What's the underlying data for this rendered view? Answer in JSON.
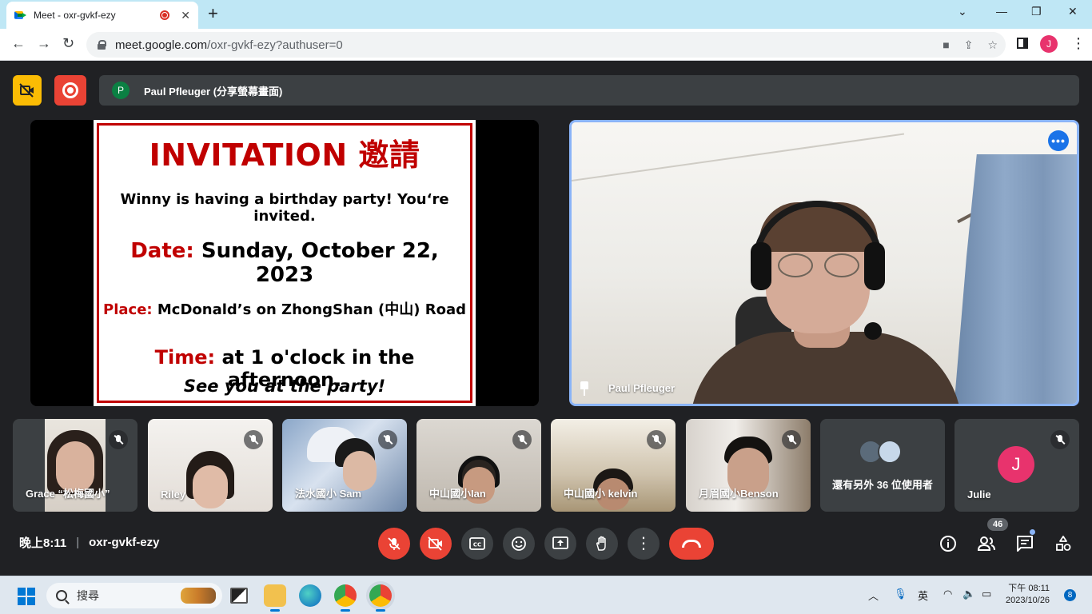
{
  "browser": {
    "tab_title": "Meet - oxr-gvkf-ezy",
    "tab_close": "✕",
    "new_tab": "+",
    "url_host": "meet.google.com",
    "url_path": "/oxr-gvkf-ezy?authuser=0",
    "profile_initial": "J"
  },
  "meet": {
    "presenter": {
      "initial": "P",
      "label": "Paul Pfleuger (分享螢幕畫面)"
    },
    "slide": {
      "title": "INVITATION 邀請",
      "line1": "Winny is having a birthday party! You‘re invited.",
      "date_label": "Date:",
      "date_value": "Sunday, October 22, 2023",
      "place_label": "Place:",
      "place_value": "McDonald’s on ZhongShan (中山) Road",
      "time_label": "Time:",
      "time_value": "at 1 o'clock in the afternoon.",
      "closing": "See you at the party!"
    },
    "main_speaker": {
      "name": "Paul Pfleuger",
      "more_label": "•••"
    },
    "participants": [
      {
        "name": "Grace “松梅國小”",
        "muted": true
      },
      {
        "name": "Riley",
        "muted": true
      },
      {
        "name": "法水國小 Sam",
        "muted": true
      },
      {
        "name": "中山國小Ian",
        "muted": true
      },
      {
        "name": "中山國小 kelvin",
        "muted": true
      },
      {
        "name": "月眉國小Benson",
        "muted": true
      }
    ],
    "others_label": "還有另外 36 位使用者",
    "julie": {
      "name": "Julie",
      "initial": "J"
    },
    "bottom": {
      "time": "晚上8:11",
      "separator": "|",
      "meeting_code": "oxr-gvkf-ezy",
      "participant_count": "46"
    }
  },
  "taskbar": {
    "search_label": "搜尋",
    "ime": "英",
    "time": "下午 08:11",
    "date": "2023/10/26",
    "notifications": "8"
  },
  "colors": {
    "meet_bg": "#202124",
    "tile_bg": "#3c4043",
    "danger": "#ea4335",
    "accent_blue": "#8ab4f8",
    "slide_red": "#c00000"
  }
}
